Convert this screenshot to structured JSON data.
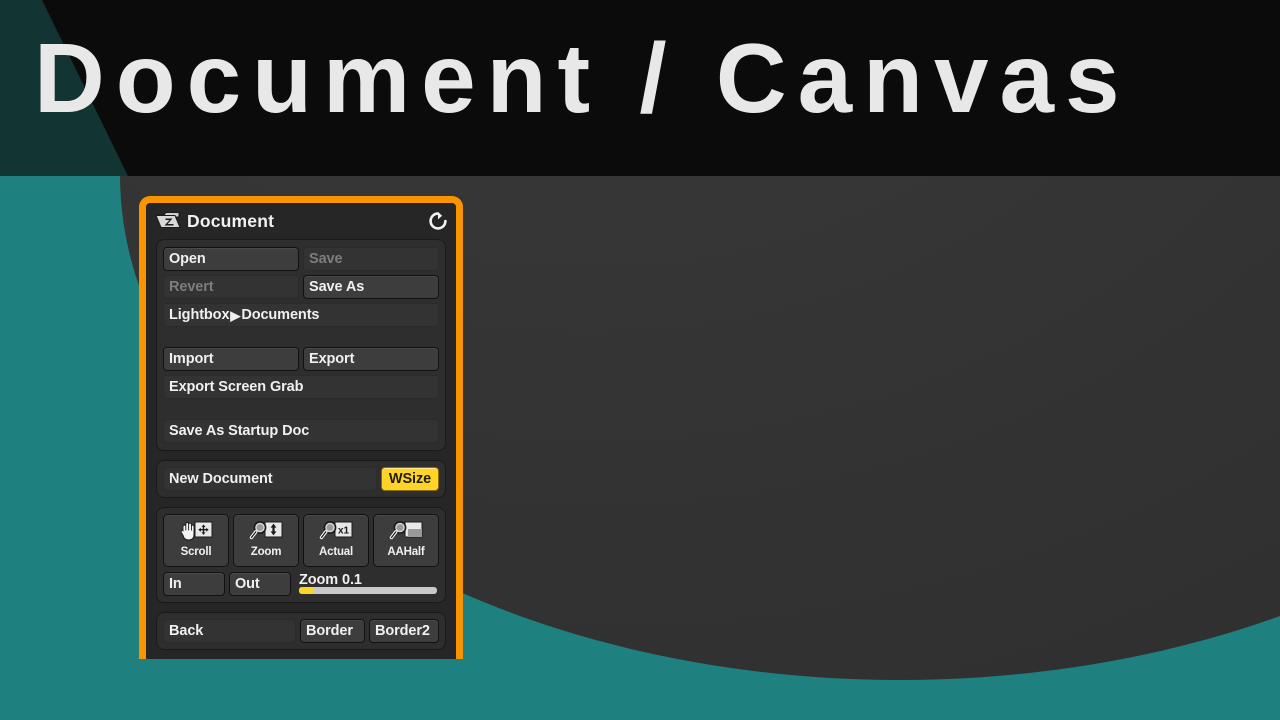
{
  "banner": {
    "title": "Document / Canvas"
  },
  "palette": {
    "title": "Document",
    "folder_icon": "zbrush-folder-icon",
    "reset_icon": "reset-circular-arrow-icon",
    "file_group": {
      "open_label": "Open",
      "save_label": "Save",
      "revert_label": "Revert",
      "save_as_label": "Save As",
      "lightbox_label": "Lightbox",
      "lightbox_arrow": "▶",
      "lightbox_target_label": "Documents",
      "import_label": "Import",
      "export_label": "Export",
      "export_screen_grab_label": "Export Screen Grab",
      "save_as_startup_label": "Save As Startup Doc"
    },
    "new_document_group": {
      "new_document_label": "New Document",
      "wsize_label": "WSize"
    },
    "navigation_group": {
      "icon_buttons": [
        {
          "label": "Scroll",
          "icon": "hand-move-icon"
        },
        {
          "label": "Zoom",
          "icon": "magnifier-updown-icon"
        },
        {
          "label": "Actual",
          "icon": "magnifier-x1-icon"
        },
        {
          "label": "AAHalf",
          "icon": "magnifier-halfbox-icon"
        }
      ],
      "in_label": "In",
      "out_label": "Out",
      "zoom_slider_label": "Zoom 0.1",
      "zoom_slider_value": 0.1,
      "zoom_slider_fill_percent": 11
    },
    "border_group": {
      "back_label": "Back",
      "border_label": "Border",
      "border2_label": "Border2"
    }
  },
  "colors": {
    "accent_orange": "#f79400",
    "highlight_yellow": "#ffd42a",
    "teal_background": "#1f8080",
    "panel_dark": "#2e2e2e",
    "banner_black": "#0b0b0b"
  }
}
